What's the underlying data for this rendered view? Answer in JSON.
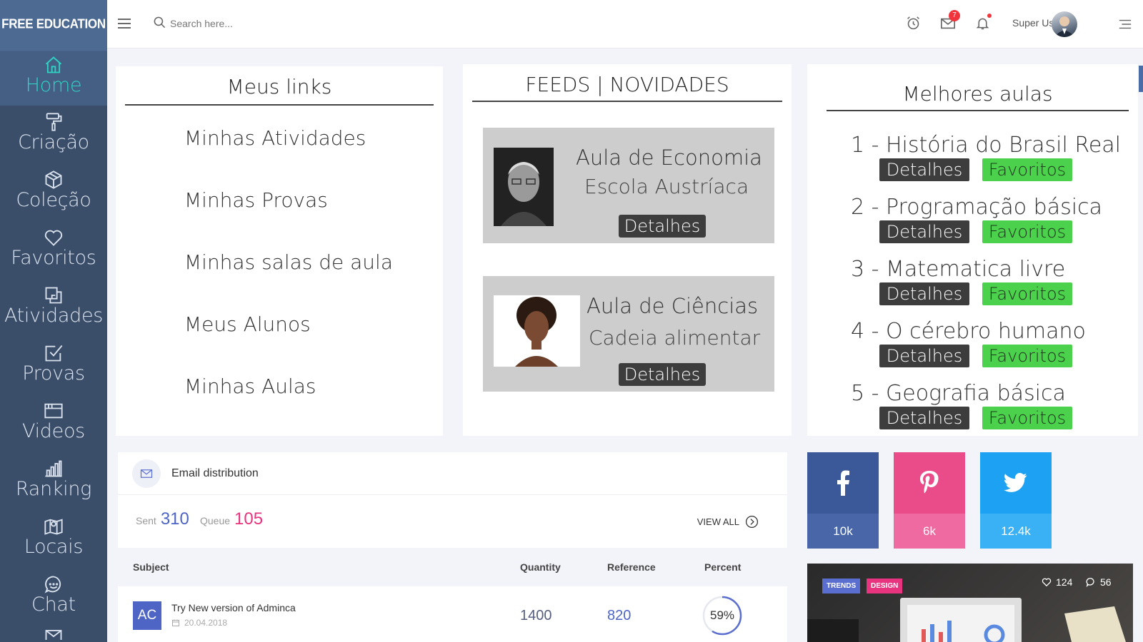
{
  "brand": "FREE EDUCATION",
  "sidebar": {
    "items": [
      {
        "label": "Home",
        "icon": "home-icon"
      },
      {
        "label": "Criação",
        "icon": "paint-roller-icon"
      },
      {
        "label": "Coleção",
        "icon": "box-icon"
      },
      {
        "label": "Favoritos",
        "icon": "heart-icon"
      },
      {
        "label": "Atividades",
        "icon": "copy-icon"
      },
      {
        "label": "Provas",
        "icon": "checkbox-icon"
      },
      {
        "label": "Videos",
        "icon": "browser-icon"
      },
      {
        "label": "Ranking",
        "icon": "bar-chart-icon"
      },
      {
        "label": "Locais",
        "icon": "map-icon"
      },
      {
        "label": "Chat",
        "icon": "chat-icon"
      }
    ]
  },
  "topbar": {
    "search_placeholder": "Search here...",
    "mail_count": "7",
    "username": "Super User"
  },
  "links_card": {
    "title": "Meus links",
    "links": [
      "Minhas Atividades",
      "Minhas Provas",
      "Minhas salas de aula",
      "Meus Alunos",
      "Minhas Aulas"
    ]
  },
  "feeds_card": {
    "title": "FEEDS | NOVIDADES",
    "items": [
      {
        "title": "Aula de Economia",
        "subtitle": "Escola Austríaca",
        "button": "Detalhes"
      },
      {
        "title": "Aula de Ciências",
        "subtitle": "Cadeia alimentar",
        "button": "Detalhes"
      }
    ]
  },
  "best_card": {
    "title": "Melhores aulas",
    "items": [
      {
        "title": "1 - História do Brasil Real"
      },
      {
        "title": "2 - Programação básica"
      },
      {
        "title": "3 - Matematica livre"
      },
      {
        "title": "4 - O cérebro humano"
      },
      {
        "title": "5 - Geografia básica"
      }
    ],
    "details_label": "Detalhes",
    "favorite_label": "Favoritos"
  },
  "email": {
    "title": "Email distribution",
    "sent_label": "Sent",
    "sent_value": "310",
    "queue_label": "Queue",
    "queue_value": "105",
    "view_all": "VIEW ALL",
    "columns": [
      "Subject",
      "Quantity",
      "Reference",
      "Percent"
    ],
    "rows": [
      {
        "avatar": "AC",
        "subject": "Try New version of Adminca",
        "date": "20.04.2018",
        "quantity": "1400",
        "reference": "820",
        "percent": "59%",
        "percent_value": 59
      }
    ]
  },
  "social": [
    {
      "network": "facebook",
      "count": "10k",
      "color": "#3b5998"
    },
    {
      "network": "pinterest",
      "count": "6k",
      "color": "#ea4c89"
    },
    {
      "network": "twitter",
      "count": "12.4k",
      "color": "#1da1f2"
    }
  ],
  "blog": {
    "tags": [
      "TRENDS",
      "DESIGN"
    ],
    "likes": "124",
    "comments": "56"
  },
  "colors": {
    "sidebar": "#3a4d69",
    "accent_teal": "#2fd3c4",
    "sent_blue": "#4e65c5",
    "queue_pink": "#e8347f",
    "favorite_green": "#4bd14b"
  }
}
